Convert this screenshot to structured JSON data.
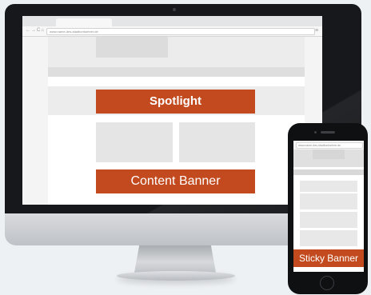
{
  "desktop": {
    "url": "www.name-des-stadtionfuehrer.de",
    "spotlight_label": "Spotlight",
    "content_banner_label": "Content Banner"
  },
  "mobile": {
    "url": "www.name-des-stadtionfuehrer.de",
    "sticky_banner_label": "Sticky Banner"
  },
  "colors": {
    "banner_accent": "#c24a1e",
    "placeholder_gray": "#e5e5e5",
    "device_bezel": "#16181b",
    "background": "#eef1f4"
  }
}
